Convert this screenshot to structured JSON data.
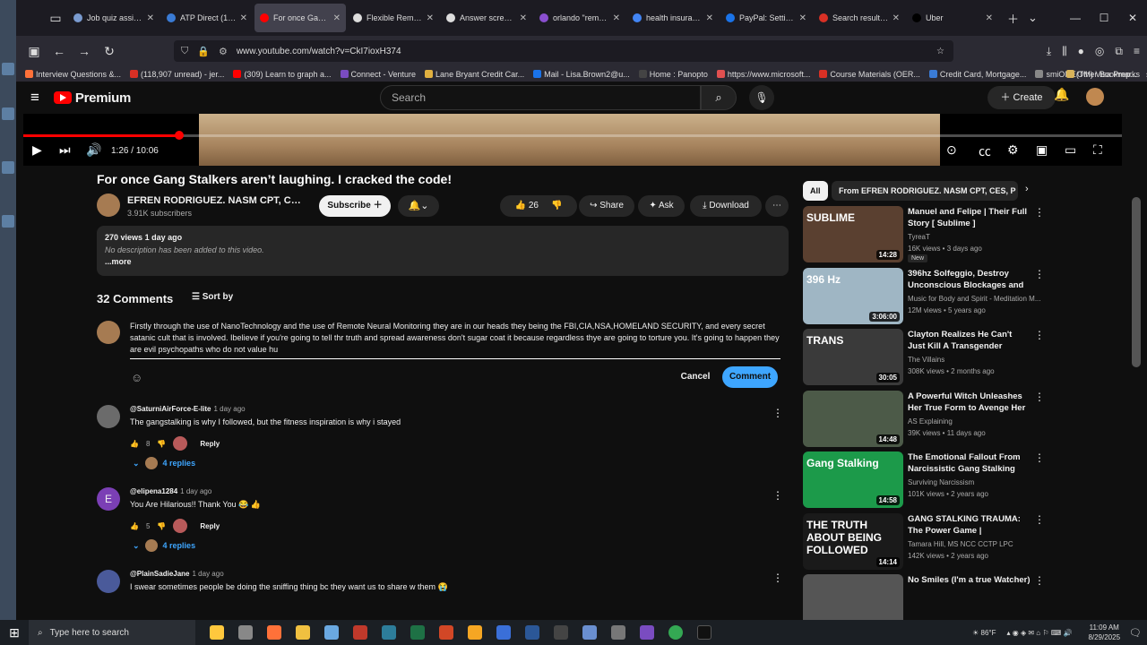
{
  "browser": {
    "tabs": [
      {
        "label": "Job quiz assistanc",
        "color": "#7a9bd0",
        "active": false
      },
      {
        "label": "ATP Direct (19720",
        "color": "#3a7bd5",
        "active": false
      },
      {
        "label": "For once Gang St",
        "color": "#ff0000",
        "active": true
      },
      {
        "label": "Flexible Remote",
        "color": "#dddddd",
        "active": false
      },
      {
        "label": "Answer screener",
        "color": "#dddddd",
        "active": false
      },
      {
        "label": "orlando \"remote",
        "color": "#8a4fcf",
        "active": false
      },
      {
        "label": "health insurance",
        "color": "#4285f4",
        "active": false
      },
      {
        "label": "PayPal: Settings",
        "color": "#1a73e8",
        "active": false
      },
      {
        "label": "Search results - ja",
        "color": "#d93025",
        "active": false
      },
      {
        "label": "Uber",
        "color": "#000000",
        "active": false
      }
    ],
    "url": "www.youtube.com/watch?v=CkI7ioxH374",
    "bookmarks": [
      "Interview Questions &...",
      "(118,907 unread) - jer...",
      "(309) Learn to graph a...",
      "Connect - Venture",
      "Lane Bryant Credit Car...",
      "Mail - Lisa.Brown2@u...",
      "Home : Panopto",
      "https://www.microsoft...",
      "Course Materials (OER...",
      "Credit Card, Mortgage...",
      "smiONE(TM) Visa Prep..."
    ],
    "other_bookmarks": "Other Bookmarks"
  },
  "youtube": {
    "logo": "Premium",
    "search_placeholder": "Search",
    "create_label": "Create",
    "player": {
      "current": "1:26",
      "duration": "10:06",
      "progress_fraction": 0.142
    },
    "video": {
      "title": "For once Gang Stalkers aren’t laughing. I cracked the code!",
      "channel": "EFREN RODRIGUEZ. NASM CPT, CES, P...",
      "subscribers": "3.91K subscribers",
      "subscribe_label": "Subscribe",
      "likes": "26",
      "share_label": "Share",
      "ask_label": "Ask",
      "download_label": "Download",
      "views": "270 views",
      "posted": "1 day ago",
      "description": "No description has been added to this video.",
      "more_label": "...more"
    },
    "comments": {
      "count_label": "32 Comments",
      "sort_label": "Sort by",
      "draft": "Firstly through the use of NanoTechnology and the use of Remote Neural Monitoring they are in our heads they being the FBI,CIA,NSA,HOMELAND SECURITY, and every secret satanic cult that is involved. Ibelieve if you're going to tell thr truth and spread awareness don't sugar coat it because regardless thye are going to torture you. It's going to happen they are evil psychopaths who do not value hu",
      "cancel_label": "Cancel",
      "comment_label": "Comment",
      "reply_label": "Reply",
      "items": [
        {
          "author": "@SaturniAirForce-E-lite",
          "ago": "1 day ago",
          "text": "The gangstalking is why I followed, but the fitness inspiration is why i stayed",
          "likes": "8",
          "replies": "4 replies",
          "avatar_color": "#6b6b6b"
        },
        {
          "author": "@elipena1284",
          "ago": "1 day ago",
          "text": "You Are Hilarious!! Thank You 😂 👍",
          "likes": "5",
          "replies": "4 replies",
          "avatar_color": "#7b3fb5",
          "initial": "E"
        },
        {
          "author": "@PlainSadieJane",
          "ago": "1 day ago",
          "text": "I swear sometimes people be doing the sniffing thing bc they want us to share w them 😭",
          "avatar_color": "#4a5a9a"
        }
      ]
    },
    "sidebar": {
      "chips": [
        "All",
        "From EFREN RODRIGUEZ. NASM CPT, CES, P"
      ],
      "videos": [
        {
          "title": "Manuel and Felipe | Their Full Story [ Sublime ]",
          "channel": "TyreaT",
          "meta": "16K views • 3 days ago",
          "duration": "14:28",
          "badge": "New",
          "thumb": "#5a4030",
          "thumb_text": "SUBLIME"
        },
        {
          "title": "396hz Solfeggio, Destroy Unconscious Blockages and ...",
          "channel": "Music for Body and Spirit - Meditation M...",
          "meta": "12M views • 5 years ago",
          "duration": "3:06:00",
          "thumb": "#9fb6c4",
          "thumb_text": "396 Hz"
        },
        {
          "title": "Clayton Realizes He Can't Just Kill A Transgender",
          "channel": "The Villains",
          "meta": "308K views • 2 months ago",
          "duration": "30:05",
          "thumb": "#3a3a3a",
          "thumb_text": "TRANS"
        },
        {
          "title": "A Powerful Witch Unleashes Her True Form to Avenge Her ...",
          "channel": "AS Explaining",
          "meta": "39K views • 11 days ago",
          "duration": "14:48",
          "thumb": "#4c5a48",
          "thumb_text": ""
        },
        {
          "title": "The Emotional Fallout From Narcissistic Gang Stalking",
          "channel": "Surviving Narcissism",
          "meta": "101K views • 2 years ago",
          "duration": "14:58",
          "thumb": "#1c9a4a",
          "thumb_text": "Gang Stalking"
        },
        {
          "title": "GANG STALKING TRAUMA: The Power Game | Psychotherapy ...",
          "channel": "Tamara Hill, MS NCC CCTP LPC",
          "meta": "142K views • 2 years ago",
          "duration": "14:14",
          "thumb": "#1a1a1a",
          "thumb_text": "THE TRUTH ABOUT BEING FOLLOWED"
        },
        {
          "title": "No Smiles (I'm a true Watcher)",
          "channel": "",
          "meta": "",
          "duration": "",
          "thumb": "#555555",
          "thumb_text": ""
        }
      ]
    }
  },
  "taskbar": {
    "search_placeholder": "Type here to search",
    "temperature": "86°F",
    "time": "11:09 AM",
    "date": "8/29/2025"
  }
}
